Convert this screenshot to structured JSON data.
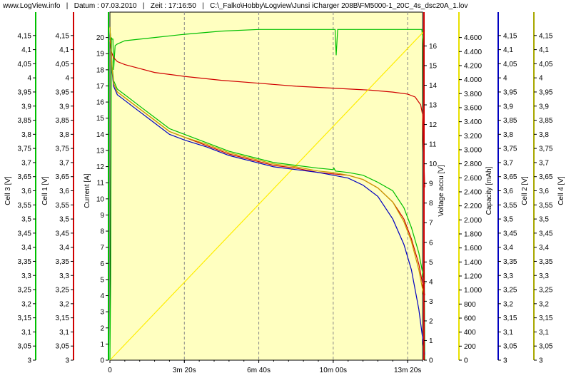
{
  "header": {
    "site": "www.LogView.info",
    "sep": "|",
    "date_label": "Datum : 07.03.2010",
    "time_label": "Zeit : 17:16:50",
    "file": "C:\\_Falko\\Hobby\\Logview\\Junsi iCharger 208B\\FM5000-1_20C_4s_dsc20A_1.lov"
  },
  "chart_data": {
    "type": "line",
    "plot_background": "#ffffc0",
    "x_axis": {
      "range": [
        0,
        840
      ],
      "ticks": [
        0,
        200,
        400,
        600,
        800
      ],
      "tick_labels": [
        "0",
        "3m 20s",
        "6m 40s",
        "10m 00s",
        "13m 20s"
      ],
      "grid": true
    },
    "axes": [
      {
        "id": "cell3",
        "label": "Cell 3 [V]",
        "color": "#00c000",
        "side": "left",
        "range": [
          3,
          4.2
        ],
        "ticks": [
          3,
          3.05,
          3.1,
          3.15,
          3.2,
          3.25,
          3.3,
          3.35,
          3.4,
          3.45,
          3.5,
          3.55,
          3.6,
          3.65,
          3.7,
          3.75,
          3.8,
          3.85,
          3.9,
          3.95,
          4,
          4.05,
          4.1,
          4.15
        ],
        "tick_labels": [
          "3",
          "3,05",
          "3,1",
          "3,15",
          "3,2",
          "3,25",
          "3,3",
          "3,35",
          "3,4",
          "3,45",
          "3,5",
          "3,55",
          "3,6",
          "3,65",
          "3,7",
          "3,75",
          "3,8",
          "3,85",
          "3,9",
          "3,95",
          "4",
          "4,05",
          "4,1",
          "4,15"
        ]
      },
      {
        "id": "cell1",
        "label": "Cell 1 [V]",
        "color": "#d00000",
        "side": "left",
        "range": [
          3,
          4.2
        ],
        "ticks": [
          3,
          3.05,
          3.1,
          3.15,
          3.2,
          3.25,
          3.3,
          3.35,
          3.4,
          3.45,
          3.5,
          3.55,
          3.6,
          3.65,
          3.7,
          3.75,
          3.8,
          3.85,
          3.9,
          3.95,
          4,
          4.05,
          4.1,
          4.15
        ],
        "tick_labels": [
          "3",
          "3,05",
          "3,1",
          "3,15",
          "3,2",
          "3,25",
          "3,3",
          "3,35",
          "3,4",
          "3,45",
          "3,5",
          "3,55",
          "3,6",
          "3,65",
          "3,7",
          "3,75",
          "3,8",
          "3,85",
          "3,9",
          "3,95",
          "4",
          "4,05",
          "4,1",
          "4,15"
        ]
      },
      {
        "id": "current",
        "label": "Current [A]",
        "color": "#00c000",
        "side": "left",
        "range": [
          0,
          21
        ],
        "ticks": [
          0,
          1,
          2,
          3,
          4,
          5,
          6,
          7,
          8,
          9,
          10,
          11,
          12,
          13,
          14,
          15,
          16,
          17,
          18,
          19,
          20
        ],
        "tick_labels": [
          "0",
          "1",
          "2",
          "3",
          "4",
          "5",
          "6",
          "7",
          "8",
          "9",
          "10",
          "11",
          "12",
          "13",
          "14",
          "15",
          "16",
          "17",
          "18",
          "19",
          "20"
        ]
      },
      {
        "id": "voltage",
        "label": "Voltage accu [V]",
        "color": "#d00000",
        "side": "right",
        "range": [
          0,
          17.25
        ],
        "ticks": [
          0,
          1,
          2,
          3,
          4,
          5,
          6,
          7,
          8,
          9,
          10,
          11,
          12,
          13,
          14,
          15,
          16
        ],
        "tick_labels": [
          "0",
          "1",
          "2",
          "3",
          "4",
          "5",
          "6",
          "7",
          "8",
          "9",
          "10",
          "11",
          "12",
          "13",
          "14",
          "15",
          "16"
        ]
      },
      {
        "id": "capacity",
        "label": "Capacity [mAh]",
        "color": "#e8e000",
        "side": "right",
        "range": [
          0,
          4830
        ],
        "ticks": [
          0,
          200,
          400,
          600,
          800,
          1000,
          1200,
          1400,
          1600,
          1800,
          2000,
          2200,
          2400,
          2600,
          2800,
          3000,
          3200,
          3400,
          3600,
          3800,
          4000,
          4200,
          4400,
          4600
        ],
        "tick_labels": [
          "0",
          "200",
          "400",
          "600",
          "800",
          "1.000",
          "1.200",
          "1.400",
          "1.600",
          "1.800",
          "2.000",
          "2.200",
          "2.400",
          "2.600",
          "2.800",
          "3.000",
          "3.200",
          "3.400",
          "3.600",
          "3.800",
          "4.000",
          "4.200",
          "4.400",
          "4.600"
        ]
      },
      {
        "id": "cell2",
        "label": "Cell 2 [V]",
        "color": "#0000c0",
        "side": "right",
        "range": [
          3,
          4.2
        ],
        "ticks": [
          3,
          3.05,
          3.1,
          3.15,
          3.2,
          3.25,
          3.3,
          3.35,
          3.4,
          3.45,
          3.5,
          3.55,
          3.6,
          3.65,
          3.7,
          3.75,
          3.8,
          3.85,
          3.9,
          3.95,
          4,
          4.05,
          4.1,
          4.15
        ],
        "tick_labels": [
          "3",
          "3,05",
          "3,1",
          "3,15",
          "3,2",
          "3,25",
          "3,3",
          "3,35",
          "3,4",
          "3,45",
          "3,5",
          "3,55",
          "3,6",
          "3,65",
          "3,7",
          "3,75",
          "3,8",
          "3,85",
          "3,9",
          "3,95",
          "4",
          "4,05",
          "4,1",
          "4,15"
        ]
      },
      {
        "id": "cell4",
        "label": "Cell 4 [V]",
        "color": "#a8a800",
        "side": "right",
        "range": [
          3,
          4.2
        ],
        "ticks": [
          3,
          3.05,
          3.1,
          3.15,
          3.2,
          3.25,
          3.3,
          3.35,
          3.4,
          3.45,
          3.5,
          3.55,
          3.6,
          3.65,
          3.7,
          3.75,
          3.8,
          3.85,
          3.9,
          3.95,
          4,
          4.05,
          4.1,
          4.15
        ],
        "tick_labels": [
          "3",
          "3,05",
          "3,1",
          "3,15",
          "3,2",
          "3,25",
          "3,3",
          "3,35",
          "3,4",
          "3,45",
          "3,5",
          "3,55",
          "3,6",
          "3,65",
          "3,7",
          "3,75",
          "3,8",
          "3,85",
          "3,9",
          "3,95",
          "4",
          "4,05",
          "4,1",
          "4,15"
        ]
      }
    ],
    "series": [
      {
        "axis": "current",
        "color": "#00c000",
        "x": [
          0,
          2,
          4,
          6,
          8,
          10,
          14,
          20,
          40,
          80,
          120,
          200,
          300,
          400,
          500,
          580,
          600,
          605,
          608,
          612,
          620,
          700,
          780,
          820,
          838,
          842,
          846
        ],
        "y": [
          0,
          5,
          20,
          19.9,
          19.9,
          18,
          19.5,
          19.6,
          19.8,
          19.9,
          20,
          20.2,
          20.4,
          20.5,
          20.5,
          20.5,
          20.5,
          20.5,
          18.9,
          20.5,
          20.5,
          20.5,
          20.5,
          20.5,
          20.5,
          19.6,
          0
        ]
      },
      {
        "axis": "voltage",
        "color": "#d00000",
        "x": [
          0,
          2,
          4,
          10,
          20,
          40,
          80,
          120,
          200,
          300,
          400,
          500,
          600,
          700,
          760,
          800,
          820,
          835,
          840,
          846
        ],
        "y": [
          16.3,
          16.1,
          15.7,
          15.4,
          15.2,
          15.05,
          14.85,
          14.65,
          14.45,
          14.25,
          14.1,
          13.95,
          13.85,
          13.75,
          13.65,
          13.55,
          13.4,
          13.0,
          12.5,
          8.8
        ]
      },
      {
        "axis": "capacity",
        "color": "#ffee00",
        "x": [
          0,
          846
        ],
        "y": [
          0,
          4700
        ]
      },
      {
        "axis": "cell1",
        "color": "#d00000",
        "x": [
          0,
          3,
          6,
          10,
          20,
          40,
          60,
          80,
          120,
          160,
          200,
          260,
          320,
          380,
          440,
          500,
          560,
          600,
          640,
          680,
          720,
          760,
          790,
          810,
          830,
          846
        ],
        "y": [
          4.18,
          4.1,
          4.03,
          3.98,
          3.95,
          3.93,
          3.91,
          3.89,
          3.85,
          3.81,
          3.79,
          3.76,
          3.73,
          3.71,
          3.69,
          3.68,
          3.665,
          3.66,
          3.655,
          3.64,
          3.61,
          3.56,
          3.5,
          3.43,
          3.34,
          3.23
        ]
      },
      {
        "axis": "cell2",
        "color": "#0000c0",
        "x": [
          0,
          3,
          6,
          10,
          20,
          40,
          60,
          80,
          120,
          160,
          200,
          260,
          320,
          380,
          440,
          500,
          560,
          600,
          640,
          680,
          720,
          760,
          790,
          810,
          830,
          846
        ],
        "y": [
          4.18,
          4.1,
          4.02,
          3.97,
          3.94,
          3.92,
          3.9,
          3.88,
          3.84,
          3.8,
          3.78,
          3.755,
          3.725,
          3.705,
          3.685,
          3.675,
          3.665,
          3.655,
          3.645,
          3.62,
          3.58,
          3.5,
          3.41,
          3.32,
          3.18,
          3.02
        ]
      },
      {
        "axis": "cell3",
        "color": "#00c000",
        "x": [
          0,
          3,
          6,
          10,
          20,
          40,
          60,
          80,
          120,
          160,
          200,
          260,
          320,
          380,
          440,
          500,
          560,
          600,
          602,
          606,
          640,
          680,
          720,
          760,
          790,
          810,
          830,
          846
        ],
        "y": [
          4.18,
          4.11,
          4.04,
          3.99,
          3.96,
          3.94,
          3.92,
          3.9,
          3.86,
          3.82,
          3.8,
          3.77,
          3.74,
          3.72,
          3.7,
          3.69,
          3.68,
          3.675,
          3.68,
          3.67,
          3.665,
          3.655,
          3.63,
          3.6,
          3.54,
          3.47,
          3.38,
          3.27
        ]
      },
      {
        "axis": "cell4",
        "color": "#c8a000",
        "x": [
          0,
          3,
          6,
          10,
          20,
          40,
          60,
          80,
          120,
          160,
          200,
          260,
          320,
          380,
          440,
          500,
          560,
          600,
          640,
          680,
          720,
          760,
          790,
          810,
          830,
          846
        ],
        "y": [
          4.18,
          4.1,
          4.03,
          3.98,
          3.95,
          3.93,
          3.91,
          3.89,
          3.85,
          3.81,
          3.79,
          3.765,
          3.735,
          3.715,
          3.695,
          3.685,
          3.67,
          3.665,
          3.655,
          3.64,
          3.61,
          3.56,
          3.49,
          3.42,
          3.32,
          3.21
        ]
      }
    ]
  }
}
